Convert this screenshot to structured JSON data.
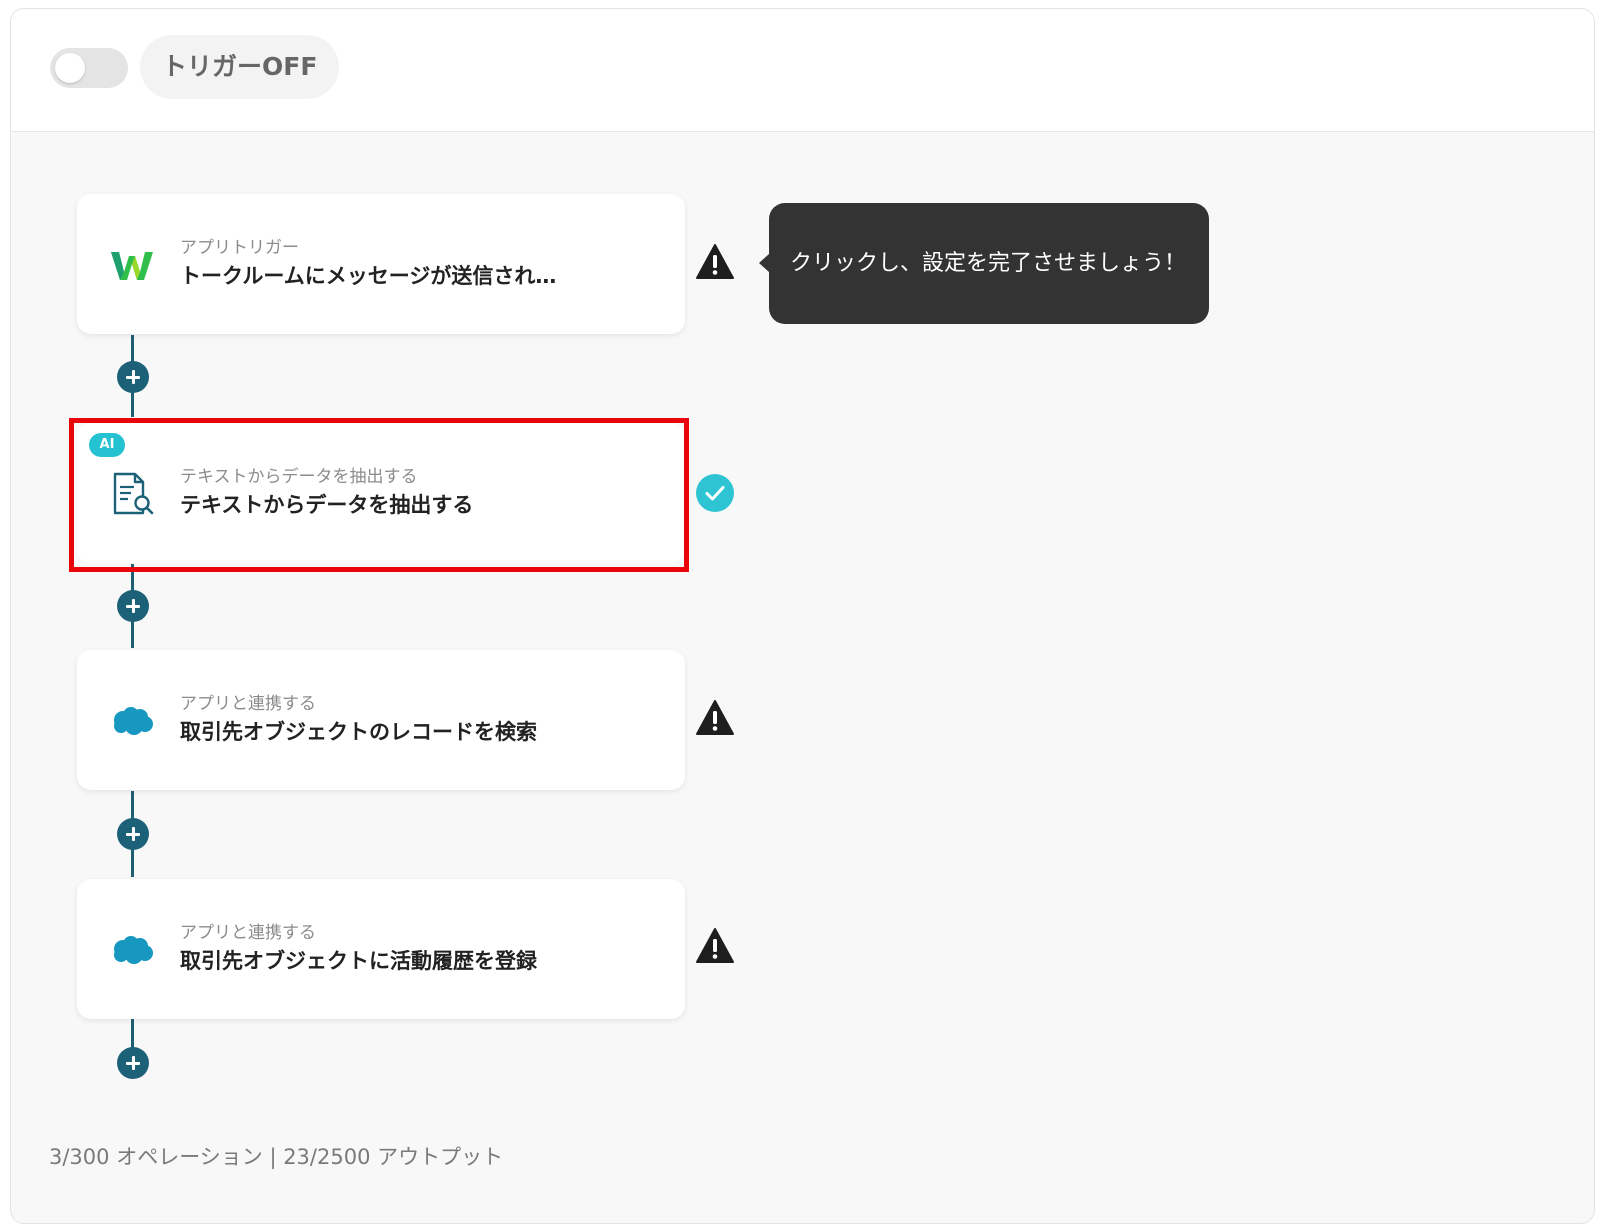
{
  "header": {
    "trigger_toggle_state": "off",
    "trigger_label": "トリガーOFF"
  },
  "flow": {
    "steps": [
      {
        "type_label": "アプリトリガー",
        "title": "トークルームにメッセージが送信され…",
        "app_icon": "works-w-logo-icon",
        "status": "warning-icon"
      },
      {
        "badge": "AI",
        "type_label": "テキストからデータを抽出する",
        "title": "テキストからデータを抽出する",
        "app_icon": "document-search-icon",
        "status": "check-icon",
        "highlighted": true
      },
      {
        "type_label": "アプリと連携する",
        "title": "取引先オブジェクトのレコードを検索",
        "app_icon": "salesforce-cloud-icon",
        "status": "warning-icon"
      },
      {
        "type_label": "アプリと連携する",
        "title": "取引先オブジェクトに活動履歴を登録",
        "app_icon": "salesforce-cloud-icon",
        "status": "warning-icon"
      }
    ]
  },
  "tooltip": {
    "text": "クリックし、設定を完了させましょう！"
  },
  "footer": {
    "usage": "3/300 オペレーション | 23/2500 アウトプット"
  },
  "colors": {
    "connector": "#1d6178",
    "highlight_border": "#e8060b",
    "ai_badge": "#25c3d1",
    "check": "#2ec4d4",
    "tooltip_bg": "#333333"
  }
}
